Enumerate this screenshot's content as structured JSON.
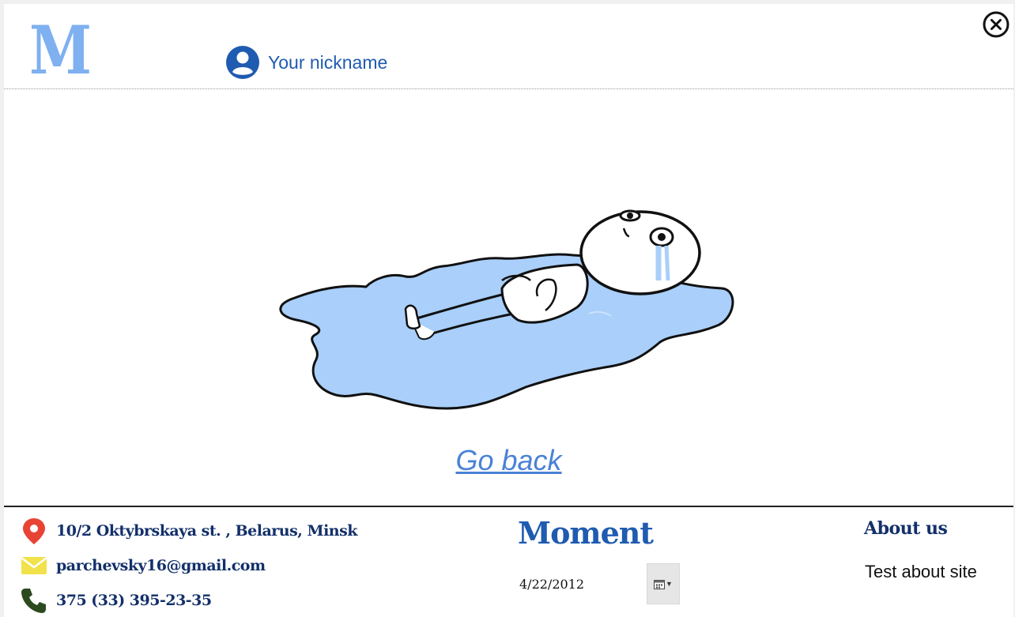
{
  "header": {
    "logo": "M",
    "user_name": "Your nickname"
  },
  "main": {
    "go_back_label": "Go back"
  },
  "footer": {
    "address": "10/2 Oktybrskaya st. , Belarus, Minsk",
    "email": "parchevsky16@gmail.com",
    "phone": "375 (33) 395-23-35",
    "brand": "Moment",
    "date": "4/22/2012",
    "date_picker_icon": "calendar-icon",
    "about_title": "About us",
    "about_text": "Test about site"
  },
  "colors": {
    "logo": "#7fb0f0",
    "accent": "#1f5bb0",
    "link": "#4a82d6",
    "footer_text": "#13306a",
    "puddle": "#a9cffa",
    "location_pin": "#e84436",
    "mail": "#f2e24a",
    "phone": "#2c4a1f"
  }
}
